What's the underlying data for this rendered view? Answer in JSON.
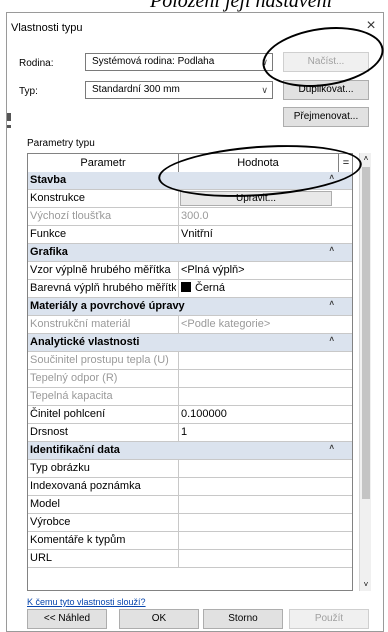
{
  "caption": "Položení její nastavení",
  "dialog": {
    "title": "Vlastnosti typu",
    "close_glyph": "×"
  },
  "family": {
    "label": "Rodina:",
    "value": "Systémová rodina: Podlaha"
  },
  "type": {
    "label": "Typ:",
    "value": "Standardní 300 mm"
  },
  "buttons": {
    "load": "Načíst...",
    "duplicate": "Duplikovat...",
    "rename": "Přejmenovat..."
  },
  "params_label": "Parametry typu",
  "grid": {
    "col_param": "Parametr",
    "col_value": "Hodnota",
    "col_eq": "=",
    "rows": [
      {
        "kind": "group",
        "name": "Stavba"
      },
      {
        "kind": "button",
        "name": "Konstrukce",
        "value": "Upravit..."
      },
      {
        "kind": "disabled",
        "name": "Výchozí tloušťka",
        "value": "300.0"
      },
      {
        "kind": "row",
        "name": "Funkce",
        "value": "Vnitřní"
      },
      {
        "kind": "group",
        "name": "Grafika"
      },
      {
        "kind": "row",
        "name": "Vzor výplně hrubého měřítka",
        "value": "<Plná výplň>"
      },
      {
        "kind": "swatch",
        "name": "Barevná výplň hrubého měřítka",
        "value": "Černá"
      },
      {
        "kind": "group",
        "name": "Materiály a povrchové úpravy"
      },
      {
        "kind": "disabled",
        "name": "Konstrukční materiál",
        "value": "<Podle kategorie>"
      },
      {
        "kind": "group",
        "name": "Analytické vlastnosti"
      },
      {
        "kind": "disabled",
        "name": "Součinitel prostupu tepla (U)",
        "value": ""
      },
      {
        "kind": "disabled",
        "name": "Tepelný odpor (R)",
        "value": ""
      },
      {
        "kind": "disabled",
        "name": "Tepelná kapacita",
        "value": ""
      },
      {
        "kind": "row",
        "name": "Činitel pohlcení",
        "value": "0.100000"
      },
      {
        "kind": "row",
        "name": "Drsnost",
        "value": "1"
      },
      {
        "kind": "group",
        "name": "Identifikační data"
      },
      {
        "kind": "row",
        "name": "Typ obrázku",
        "value": ""
      },
      {
        "kind": "row",
        "name": "Indexovaná poznámka",
        "value": ""
      },
      {
        "kind": "row",
        "name": "Model",
        "value": ""
      },
      {
        "kind": "row",
        "name": "Výrobce",
        "value": ""
      },
      {
        "kind": "row",
        "name": "Komentáře k typům",
        "value": ""
      },
      {
        "kind": "row",
        "name": "URL",
        "value": ""
      }
    ]
  },
  "help_link": "K čemu tyto vlastnosti slouží?",
  "footer": {
    "preview": "<< Náhled",
    "ok": "OK",
    "cancel": "Storno",
    "apply": "Použít"
  },
  "icons": {
    "collapse": "˄",
    "dropdown": "∨",
    "scroll_up": "˄",
    "scroll_down": "˅"
  }
}
